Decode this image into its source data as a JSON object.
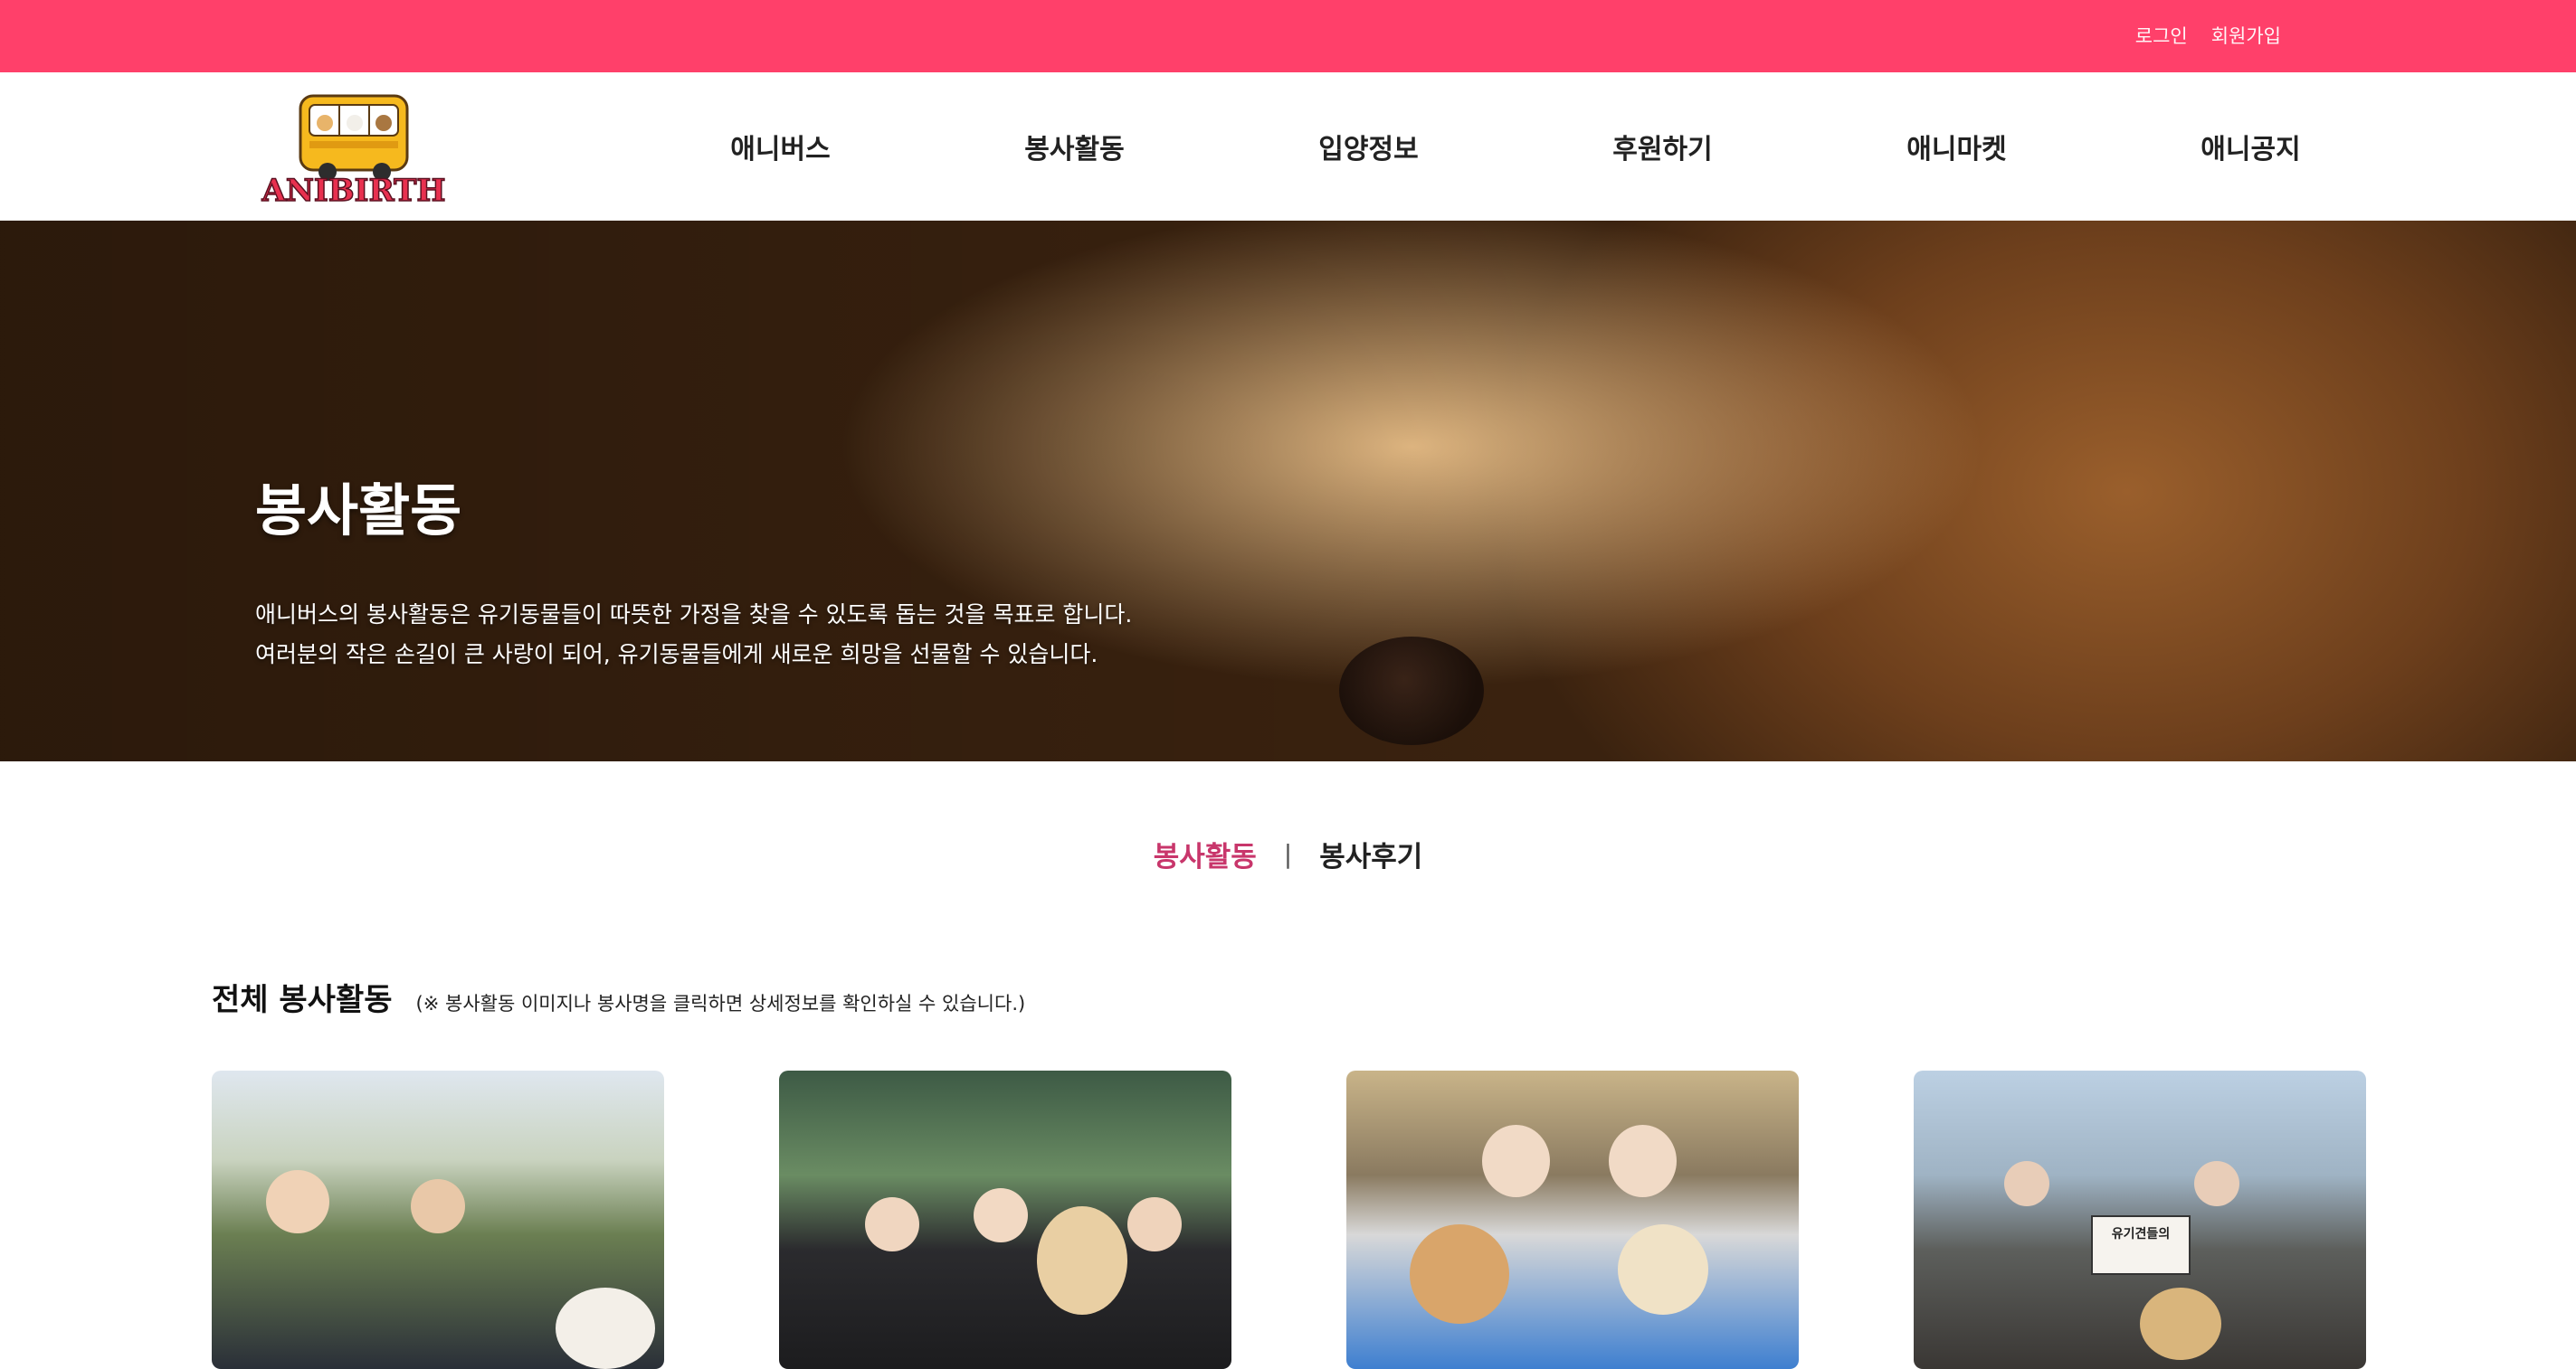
{
  "topbar": {
    "login_label": "로그인",
    "signup_label": "회원가입",
    "color": "#ff406a"
  },
  "header": {
    "logo_text": "ANIBIRTH",
    "nav": [
      "애니버스",
      "봉사활동",
      "입양정보",
      "후원하기",
      "애니마켓",
      "애니공지"
    ]
  },
  "hero": {
    "title": "봉사활동",
    "line1": "애니버스의 봉사활동은 유기동물들이 따뜻한 가정을 찾을 수 있도록 돕는 것을 목표로 합니다.",
    "line2": "여러분의 작은 손길이 큰 사랑이 되어, 유기동물들에게 새로운 희망을 선물할 수 있습니다."
  },
  "subtabs": {
    "active": "봉사활동",
    "separator": "|",
    "other": "봉사후기",
    "active_color": "#c8366b"
  },
  "section": {
    "title": "전체 봉사활동",
    "note": "(※ 봉사활동 이미지나 봉사명을 클릭하면 상세정보를 확인하실 수 있습니다.)"
  },
  "cards": [
    {
      "image": "volunteer-photo-1"
    },
    {
      "image": "volunteer-photo-2"
    },
    {
      "image": "volunteer-photo-3"
    },
    {
      "image": "volunteer-photo-4",
      "sign_text": "유기견들의"
    }
  ]
}
